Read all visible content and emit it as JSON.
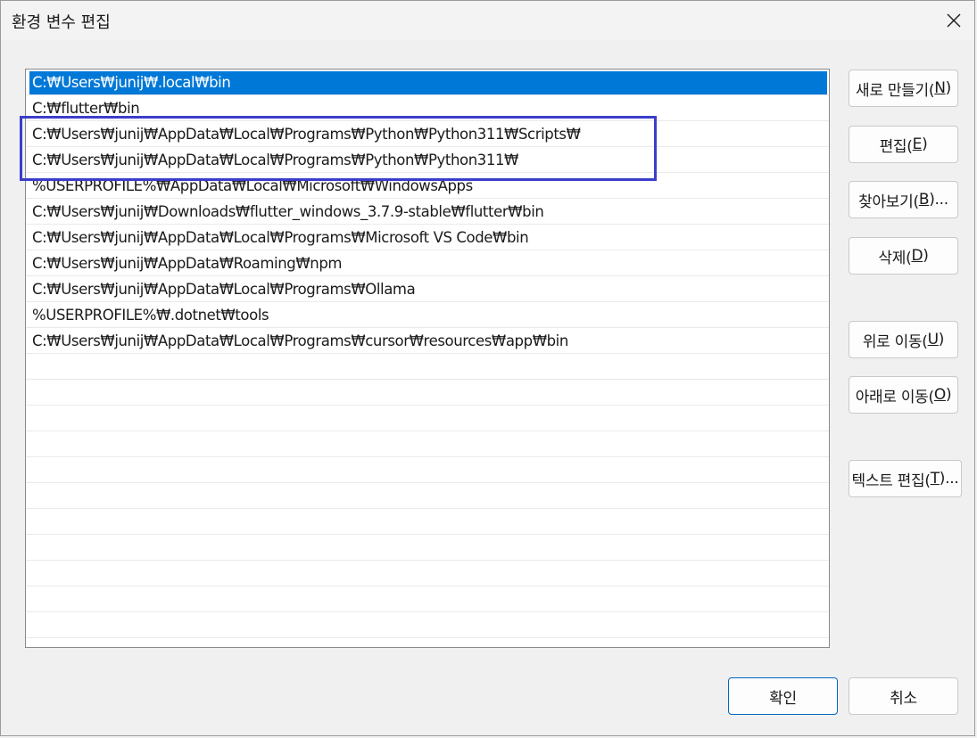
{
  "window": {
    "title": "환경 변수 편집"
  },
  "paths": [
    "C:₩Users₩junij₩.local₩bin",
    "C:₩flutter₩bin",
    "C:₩Users₩junij₩AppData₩Local₩Programs₩Python₩Python311₩Scripts₩",
    "C:₩Users₩junij₩AppData₩Local₩Programs₩Python₩Python311₩",
    "%USERPROFILE%₩AppData₩Local₩Microsoft₩WindowsApps",
    "C:₩Users₩junij₩Downloads₩flutter_windows_3.7.9-stable₩flutter₩bin",
    "C:₩Users₩junij₩AppData₩Local₩Programs₩Microsoft VS Code₩bin",
    "C:₩Users₩junij₩AppData₩Roaming₩npm",
    "C:₩Users₩junij₩AppData₩Local₩Programs₩Ollama",
    "%USERPROFILE%₩.dotnet₩tools",
    "C:₩Users₩junij₩AppData₩Local₩Programs₩cursor₩resources₩app₩bin"
  ],
  "selected_index": 0,
  "buttons": {
    "new": {
      "label": "새로 만들기(",
      "key": "N",
      "suffix": ")"
    },
    "edit": {
      "label": "편집(",
      "key": "E",
      "suffix": ")"
    },
    "browse": {
      "label": "찾아보기(",
      "key": "B",
      "suffix": ")..."
    },
    "delete": {
      "label": "삭제(",
      "key": "D",
      "suffix": ")"
    },
    "move_up": {
      "label": "위로 이동(",
      "key": "U",
      "suffix": ")"
    },
    "move_down": {
      "label": "아래로 이동(",
      "key": "O",
      "suffix": ")"
    },
    "edit_text": {
      "label": "텍스트 편집(",
      "key": "T",
      "suffix": ")..."
    },
    "ok": {
      "label": "확인"
    },
    "cancel": {
      "label": "취소"
    }
  },
  "colors": {
    "selection": "#0078d7",
    "annotation_box": "#3b3ec9"
  },
  "icons": {
    "close": "close-icon"
  }
}
